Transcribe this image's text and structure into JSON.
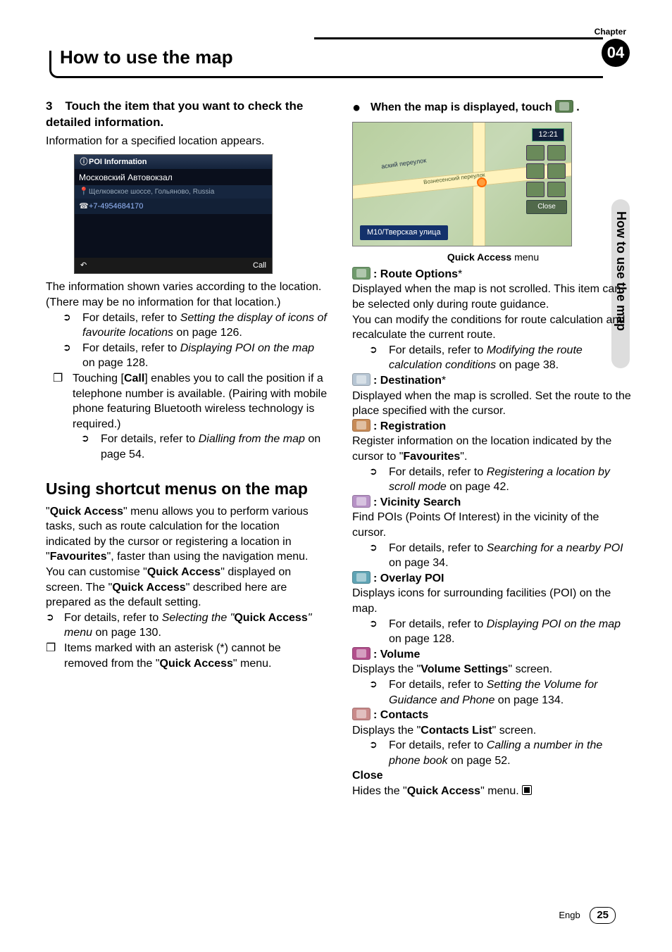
{
  "chapter": {
    "label": "Chapter",
    "number": "04"
  },
  "header_title": "How to use the map",
  "side_tab": "How to use the map",
  "footer": {
    "lang": "Engb",
    "page": "25"
  },
  "left": {
    "step3_num": "3",
    "step3_head": "Touch the item that you want to check the detailed information.",
    "step3_line": "Information for a specified location appears.",
    "poi": {
      "title": "POI Information",
      "name": "Московский Автовокзал",
      "address": "Щелковское шоссе, Гольяново, Russia",
      "phone": "+7-4954684170",
      "back": "↶",
      "call": "Call"
    },
    "varies": "The information shown varies according to the location. (There may be no information for that location.)",
    "b1": "For details, refer to ",
    "b1_it": "Setting the display of icons of favourite locations",
    "b1_tail": " on page 126.",
    "b2": "For details, refer to ",
    "b2_it": "Displaying POI on the map",
    "b2_tail": " on page 128.",
    "call_txt1": "Touching [",
    "call_bold": "Call",
    "call_txt2": "] enables you to call the position if a telephone number is available. (Pairing with mobile phone featuring Bluetooth wireless technology is required.)",
    "b3": "For details, refer to ",
    "b3_it": "Dialling from the map",
    "b3_tail": " on page 54.",
    "h2": "Using shortcut menus on the map",
    "p1a": "\"",
    "p1b": "Quick Access",
    "p1c": "\" menu allows you to perform various tasks, such as route calculation for the location indicated by the cursor or registering a location in \"",
    "p1d": "Favourites",
    "p1e": "\", faster than using the navigation menu.",
    "p2a": "You can customise \"",
    "p2b": "Quick Access",
    "p2c": "\" displayed on screen. The \"",
    "p2d": "Quick Access",
    "p2e": "\" described here are prepared as the default setting.",
    "b4": "For details, refer to ",
    "b4_it1": "Selecting the \"",
    "b4_bold": "Quick Access",
    "b4_it2": "\" menu",
    "b4_tail": " on page 130.",
    "b5a": "Items marked with an asterisk (*) cannot be removed from the \"",
    "b5b": "Quick Access",
    "b5c": "\" menu."
  },
  "right": {
    "instr_a": "When the map is displayed, touch ",
    "instr_b": ".",
    "map": {
      "time": "12:21",
      "street1": "аский переулок",
      "street2": "Вознесенский переулок",
      "close": "Close",
      "bar": "М10/Тверская улица"
    },
    "caption_a": "Quick Access",
    "caption_b": " menu",
    "route_head": "Route Options",
    "route_star": "*",
    "route_p": "Displayed when the map is not scrolled. This item can be selected only during route guidance.",
    "route_p2": "You can modify the conditions for route calculation and recalculate the current route.",
    "route_ref": "For details, refer to ",
    "route_ref_it": "Modifying the route calculation conditions",
    "route_ref_tail": " on page 38.",
    "dest_head": "Destination",
    "dest_star": "*",
    "dest_p": "Displayed when the map is scrolled. Set the route to the place specified with the cursor.",
    "reg_head": "Registration",
    "reg_p1": "Register information on the location indicated by the cursor to \"",
    "reg_p2": "Favourites",
    "reg_p3": "\".",
    "reg_ref": "For details, refer to ",
    "reg_ref_it": "Registering a location by scroll mode",
    "reg_ref_tail": " on page 42.",
    "vic_head": "Vicinity Search",
    "vic_p": "Find POIs (Points Of Interest) in the vicinity of the cursor.",
    "vic_ref": "For details, refer to ",
    "vic_ref_it": "Searching for a nearby POI",
    "vic_ref_tail": " on page 34.",
    "ovl_head": "Overlay POI",
    "ovl_p": "Displays icons for surrounding facilities (POI) on the map.",
    "ovl_ref": "For details, refer to ",
    "ovl_ref_it": "Displaying POI on the map",
    "ovl_ref_tail": " on page 128.",
    "vol_head": "Volume",
    "vol_p1": "Displays the \"",
    "vol_p2": "Volume Settings",
    "vol_p3": "\" screen.",
    "vol_ref": "For details, refer to ",
    "vol_ref_it": "Setting the Volume for Guidance and Phone",
    "vol_ref_tail": " on page 134.",
    "con_head": "Contacts",
    "con_p1": "Displays the \"",
    "con_p2": "Contacts List",
    "con_p3": "\" screen.",
    "con_ref": "For details, refer to ",
    "con_ref_it": "Calling a number in the phone book",
    "con_ref_tail": " on page 52.",
    "close_head": "Close",
    "close_p1": "Hides the \"",
    "close_p2": "Quick Access",
    "close_p3": "\" menu."
  }
}
